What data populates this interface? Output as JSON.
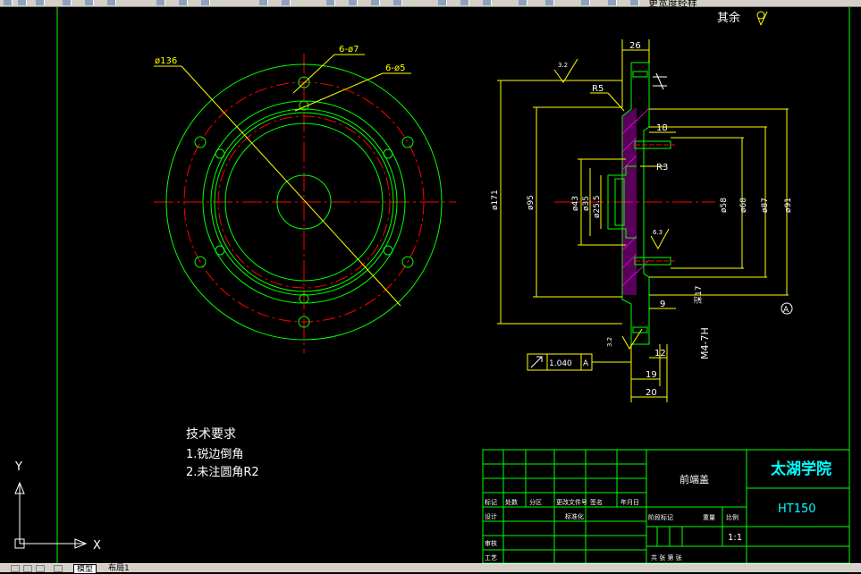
{
  "toolbar": {
    "right_text": "更宽度经样"
  },
  "drawing": {
    "roughness_note": "其余",
    "front_view": {
      "dia_136": "ø136",
      "holes_7": "6-ø7",
      "holes_5": "6-ø5"
    },
    "section_view": {
      "dim_26": "26",
      "rough_32": "3.2",
      "rough_63": "6.3",
      "r5": "R5",
      "r3": "R3",
      "dim_18": "18",
      "dim_9": "9",
      "dim_12": "12",
      "dim_19": "19",
      "dim_20": "20",
      "d171": "ø171",
      "d95": "ø95",
      "d43": "ø43",
      "d35": "ø35",
      "d255": "ø25.5",
      "d58": "ø58",
      "d68": "ø68",
      "d87": "ø87",
      "d91": "ø91",
      "thread": "M4-7H",
      "thread_depth": "深17",
      "datum": "A",
      "tolerance_value": "1.040",
      "tolerance_datum": "A"
    },
    "tech_title": "技术要求",
    "tech_1": "1.锐边倒角",
    "tech_2": "2.未注圆角R2",
    "ucs_y": "Y",
    "ucs_x": "X"
  },
  "title_block": {
    "part_name": "前端盖",
    "school": "太湖学院",
    "material": "HT150",
    "scale": "1:1",
    "col1": "标记",
    "col2": "处数",
    "col3": "分区",
    "col4": "更改文件号",
    "col5": "签名",
    "col6": "年月日",
    "design": "设计",
    "standard": "标准化",
    "stage": "阶段标记",
    "weight": "重量",
    "ratio": "比例",
    "review": "审核",
    "process": "工艺",
    "sheet": "共 张 第 张"
  },
  "tabs": {
    "model": "模型",
    "layout1": "布局1"
  },
  "colors": {
    "green": "#00ff00",
    "red": "#ff0000",
    "yellow": "#ffff00",
    "white": "#ffffff",
    "cyan": "#00ffff",
    "magenta": "#ff00ff"
  }
}
